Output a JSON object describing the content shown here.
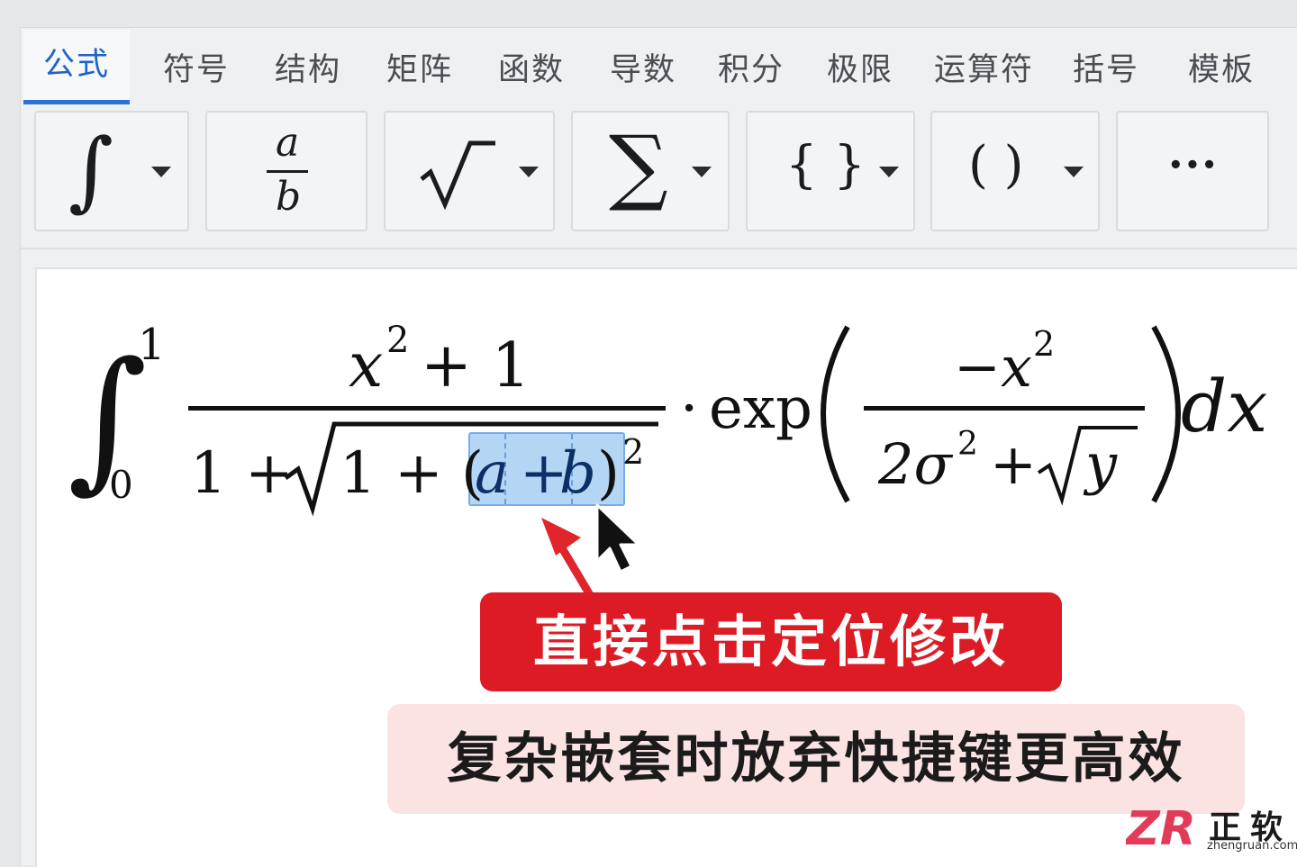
{
  "tabs": [
    "公式",
    "符号",
    "结构",
    "矩阵",
    "函数",
    "导数",
    "积分",
    "极限",
    "运算符",
    "括号",
    "模板"
  ],
  "toolbar": {
    "integral_symbol": "∫",
    "fraction_numerator": "a",
    "fraction_denominator": "b",
    "radical_symbol": "√",
    "sum_symbol": "∑",
    "braces_symbol": "{ }",
    "parens_symbol": "( )",
    "more_symbol": "•••"
  },
  "formula": {
    "integral_sign": "∫",
    "upper_limit": "1",
    "lower_limit": "0",
    "numerator_base": "x",
    "numerator_exp": "2",
    "numerator_rest": "+ 1",
    "denom_prefix": "1 + ",
    "denom_radicand_prefix": "1 + (",
    "sel_a": "a",
    "sel_plus": "+",
    "sel_b": "b",
    "close_paren": ")",
    "denom_exp": "2",
    "dot": "·",
    "func": "exp",
    "inner_num": "−x",
    "inner_num_exp": "2",
    "inner_den_2": "2σ",
    "inner_den_exp": "2",
    "inner_den_plus": "+",
    "inner_den_y": "y",
    "dx": "dx"
  },
  "callouts": {
    "primary": "直接点击定位修改",
    "secondary": "复杂嵌套时放弃快捷键更高效"
  },
  "watermark": {
    "logo_text": "ZR",
    "cn": "正软",
    "en": "zhengruan.com"
  },
  "colors": {
    "accent": "#1f63c7",
    "callout_red": "#dd1b24",
    "callout_pink_bg": "#fbe3e3",
    "arrow_red": "#e0252c",
    "selection": "#78b2ec"
  }
}
